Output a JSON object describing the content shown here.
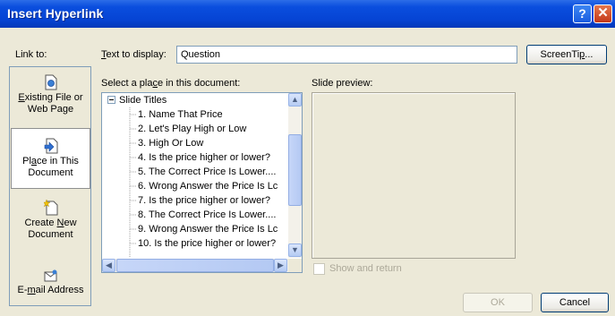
{
  "window": {
    "title": "Insert Hyperlink",
    "help_glyph": "?",
    "close_glyph": "✕"
  },
  "link_to_label": "Link to:",
  "text_to_display": {
    "label": "Text to display:",
    "value": "Question"
  },
  "screentip_button": "ScreenTip...",
  "select_place_label": "Select a place in this document:",
  "slide_preview_label": "Slide preview:",
  "sidebar": {
    "items": [
      {
        "line1": "Existing File or",
        "line2": "Web Page",
        "icon": "existing-file-icon"
      },
      {
        "line1": "Place in This",
        "line2": "Document",
        "icon": "place-in-document-icon",
        "selected": true
      },
      {
        "line1": "Create New",
        "line2": "Document",
        "icon": "new-document-icon"
      },
      {
        "line1": "E-mail Address",
        "line2": "",
        "icon": "email-icon"
      }
    ]
  },
  "tree": {
    "root": "Slide Titles",
    "items": [
      "1. Name That Price",
      "2. Let's Play High or Low",
      "3. High Or Low",
      "4. Is the price higher or lower?",
      "5. The Correct Price Is Lower....",
      "6. Wrong Answer the Price Is Lc",
      "7. Is the price higher or lower?",
      "8. The Correct Price Is Lower....",
      "9. Wrong Answer the Price Is Lc",
      "10. Is the price higher or lower?"
    ]
  },
  "show_and_return": {
    "label": "Show and return",
    "checked": false,
    "enabled": false
  },
  "ok_button": "OK",
  "cancel_button": "Cancel",
  "colors": {
    "titlebar": "#0A4EDE",
    "dialog_bg": "#ECE9D8",
    "border": "#7F9DB9"
  }
}
